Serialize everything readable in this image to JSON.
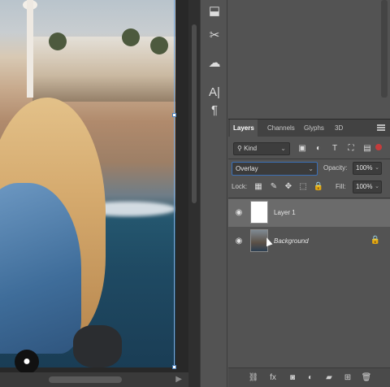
{
  "canvas": {
    "avatar_glyph": "●"
  },
  "tools": [
    {
      "name": "stamp-tool-icon",
      "glyph": "⬓"
    },
    {
      "name": "scissors-tool-icon",
      "glyph": "✂"
    },
    {
      "name": "cloud-libraries-icon",
      "glyph": "☁"
    },
    {
      "name": "character-panel-icon",
      "glyph": "A|"
    },
    {
      "name": "paragraph-panel-icon",
      "glyph": "¶"
    }
  ],
  "layers_panel": {
    "tabs": [
      "Layers",
      "Channels",
      "Glyphs",
      "3D"
    ],
    "filter_kind": "Kind",
    "filter_icons": [
      "image-filter-icon",
      "adjustment-filter-icon",
      "type-filter-icon",
      "shape-filter-icon",
      "smart-object-filter-icon"
    ],
    "blend_mode": "Overlay",
    "opacity_label": "Opacity:",
    "opacity_value": "100%",
    "lock_label": "Lock:",
    "fill_label": "Fill:",
    "fill_value": "100%",
    "layers": [
      {
        "name": "Layer 1",
        "selected": true,
        "thumbnail": "white"
      },
      {
        "name": "Background",
        "selected": false,
        "thumbnail": "photo",
        "locked": true
      }
    ],
    "bottom_icons": [
      "link-layers-icon",
      "fx-icon",
      "add-mask-icon",
      "adjustment-layer-icon",
      "group-folder-icon",
      "new-layer-icon",
      "delete-layer-icon"
    ]
  },
  "colors": {
    "panel_bg": "#535353",
    "selected_layer": "#6b6b6b",
    "blend_select_border": "#3b6fb6"
  }
}
